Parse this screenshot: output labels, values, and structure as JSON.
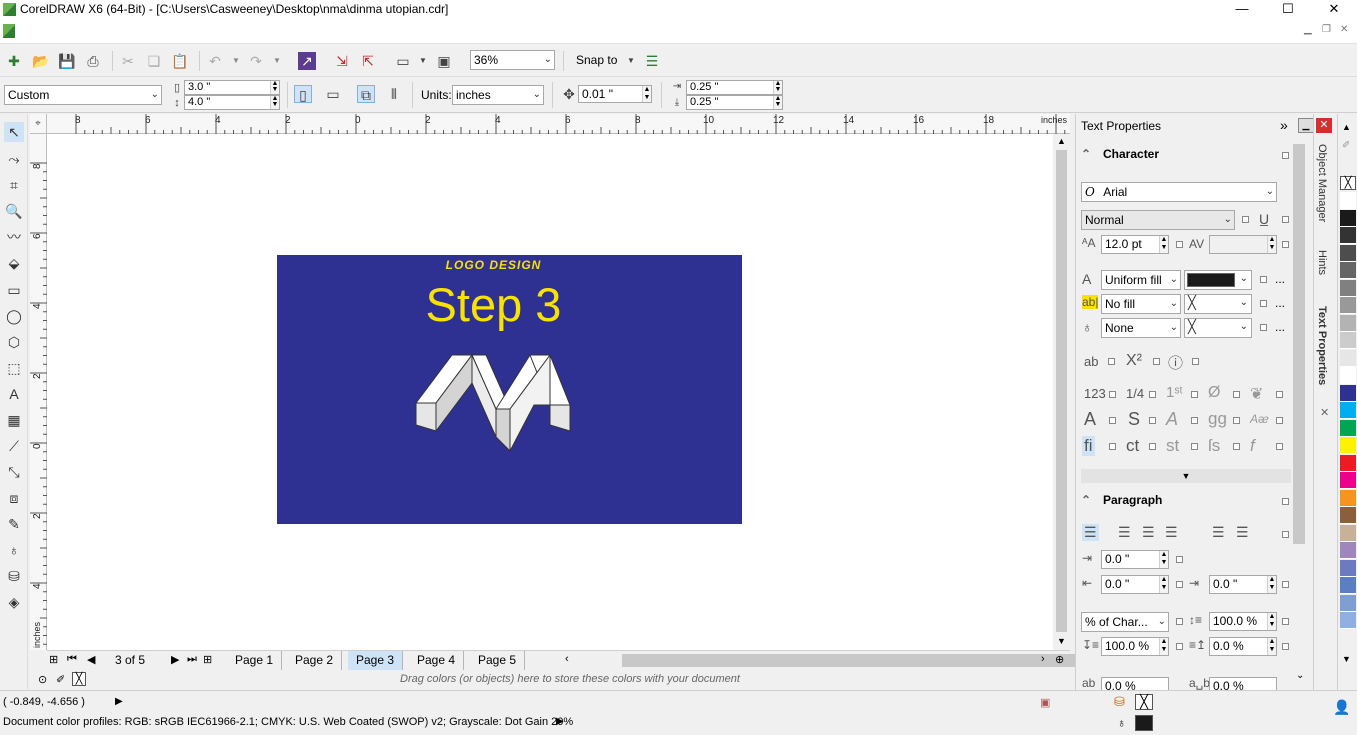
{
  "window": {
    "title": "CorelDRAW X6 (64-Bit) - [C:\\Users\\Casweeney\\Desktop\\nma\\dinma utopian.cdr]",
    "minimize": "—",
    "maximize": "☐",
    "close": "✕"
  },
  "toolbar": {
    "zoom": "36%",
    "snap_to": "Snap to"
  },
  "propertybar": {
    "preset": "Custom",
    "width": "3.0 \"",
    "height": "4.0 \"",
    "units_label": "Units:",
    "units": "inches",
    "nudge": "0.01 \"",
    "dup_x": "0.25 \"",
    "dup_y": "0.25 \""
  },
  "ruler": {
    "h_labels": [
      "8",
      "6",
      "4",
      "2",
      "0",
      "2",
      "4",
      "6",
      "8",
      "10",
      "12",
      "14",
      "16",
      "18"
    ],
    "h_unit": "inches",
    "v_labels": [
      "8",
      "6",
      "4",
      "2",
      "0",
      "2",
      "4"
    ],
    "v_unit": "inches"
  },
  "artwork": {
    "small_title": "LOGO DESIGN",
    "big_title": "Step 3",
    "background_color": "#2e3192",
    "text_color": "#f9e200"
  },
  "pagebar": {
    "page_counter": "3 of 5",
    "pages": [
      "Page 1",
      "Page 2",
      "Page 3",
      "Page 4",
      "Page 5"
    ],
    "active_page": "Page 3"
  },
  "dragbar": {
    "message": "Drag colors (or objects) here to store these colors with your document"
  },
  "status": {
    "coords": "( -0.849, -4.656 )",
    "profiles": "Document color profiles: RGB: sRGB IEC61966-2.1; CMYK: U.S. Web Coated (SWOP) v2; Grayscale: Dot Gain 20%"
  },
  "docker": {
    "title": "Text Properties",
    "character_header": "Character",
    "font": "Arial",
    "font_style": "Normal",
    "font_size": "12.0 pt",
    "fill_type": "Uniform fill",
    "bg_fill": "No fill",
    "outline": "None",
    "paragraph_header": "Paragraph",
    "indent_first": "0.0 \"",
    "indent_left": "0.0 \"",
    "indent_right": "0.0 \"",
    "spacing_unit": "% of Char...",
    "line_spacing": "100.0 %",
    "para_before": "100.0 %",
    "para_after": "0.0 %",
    "bottom_left": "0.0 %",
    "bottom_right": "0.0 %",
    "more": "..."
  },
  "sidetabs": {
    "object_manager": "Object Manager",
    "hints": "Hints",
    "text_properties": "Text Properties"
  },
  "palette_colors": [
    "#ffffff",
    "#1a1a1a",
    "#333333",
    "#4d4d4d",
    "#666666",
    "#808080",
    "#999999",
    "#b3b3b3",
    "#cccccc",
    "#e6e6e6",
    "#ffffff",
    "#2e3192",
    "#00aeef",
    "#00a651",
    "#fff200",
    "#ed1c24",
    "#ec008c",
    "#f7941d",
    "#8b5e3c",
    "#c7b299",
    "#a186be",
    "#6c7bbf",
    "#5b7fc2",
    "#7f9fd4",
    "#8fb0e0"
  ]
}
